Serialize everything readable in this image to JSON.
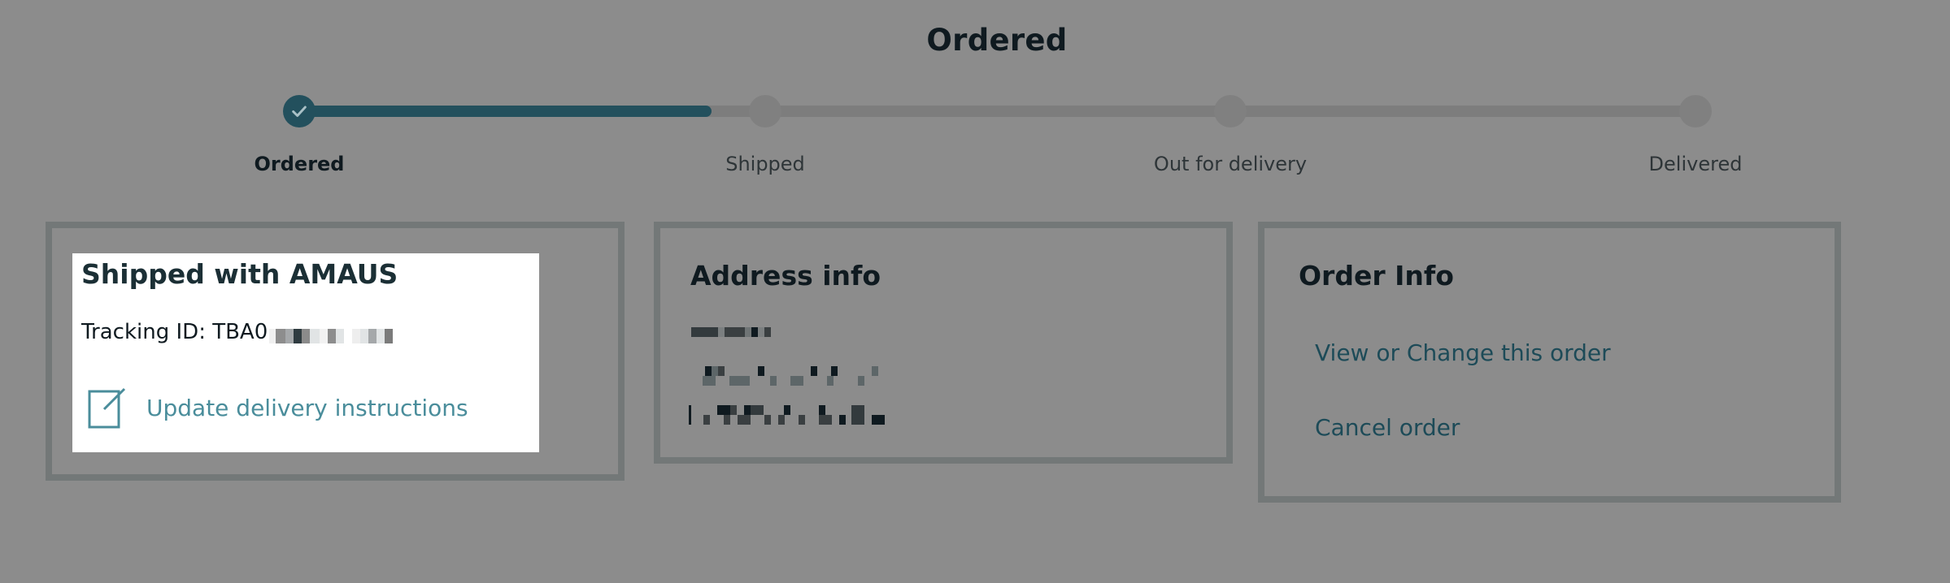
{
  "page": {
    "title": "Ordered"
  },
  "tracker": {
    "progress_fraction": 0.295,
    "current_step": 0,
    "steps": [
      {
        "label": "Ordered",
        "status": "complete",
        "icon": "check-icon"
      },
      {
        "label": "Shipped",
        "status": "pending"
      },
      {
        "label": "Out for delivery",
        "status": "pending"
      },
      {
        "label": "Delivered",
        "status": "pending"
      }
    ],
    "colors": {
      "complete": "#23505d",
      "pending": "#7d7d7d"
    }
  },
  "shipping_card": {
    "heading": "Shipped with AMAUS",
    "tracking_label": "Tracking ID: TBA0",
    "tracking_value_redacted": true,
    "update_link": {
      "label": "Update delivery instructions",
      "icon": "edit-note-icon"
    }
  },
  "address_card": {
    "heading": "Address info",
    "lines_redacted": 3
  },
  "order_card": {
    "heading": "Order Info",
    "links": [
      {
        "label": "View or Change this order"
      },
      {
        "label": "Cancel order"
      }
    ]
  },
  "colors": {
    "overlay": "#8c8c8c",
    "card_border": "#737878",
    "link_highlighted": "#4a8d9b",
    "link_dimmed": "#1d4b58"
  }
}
